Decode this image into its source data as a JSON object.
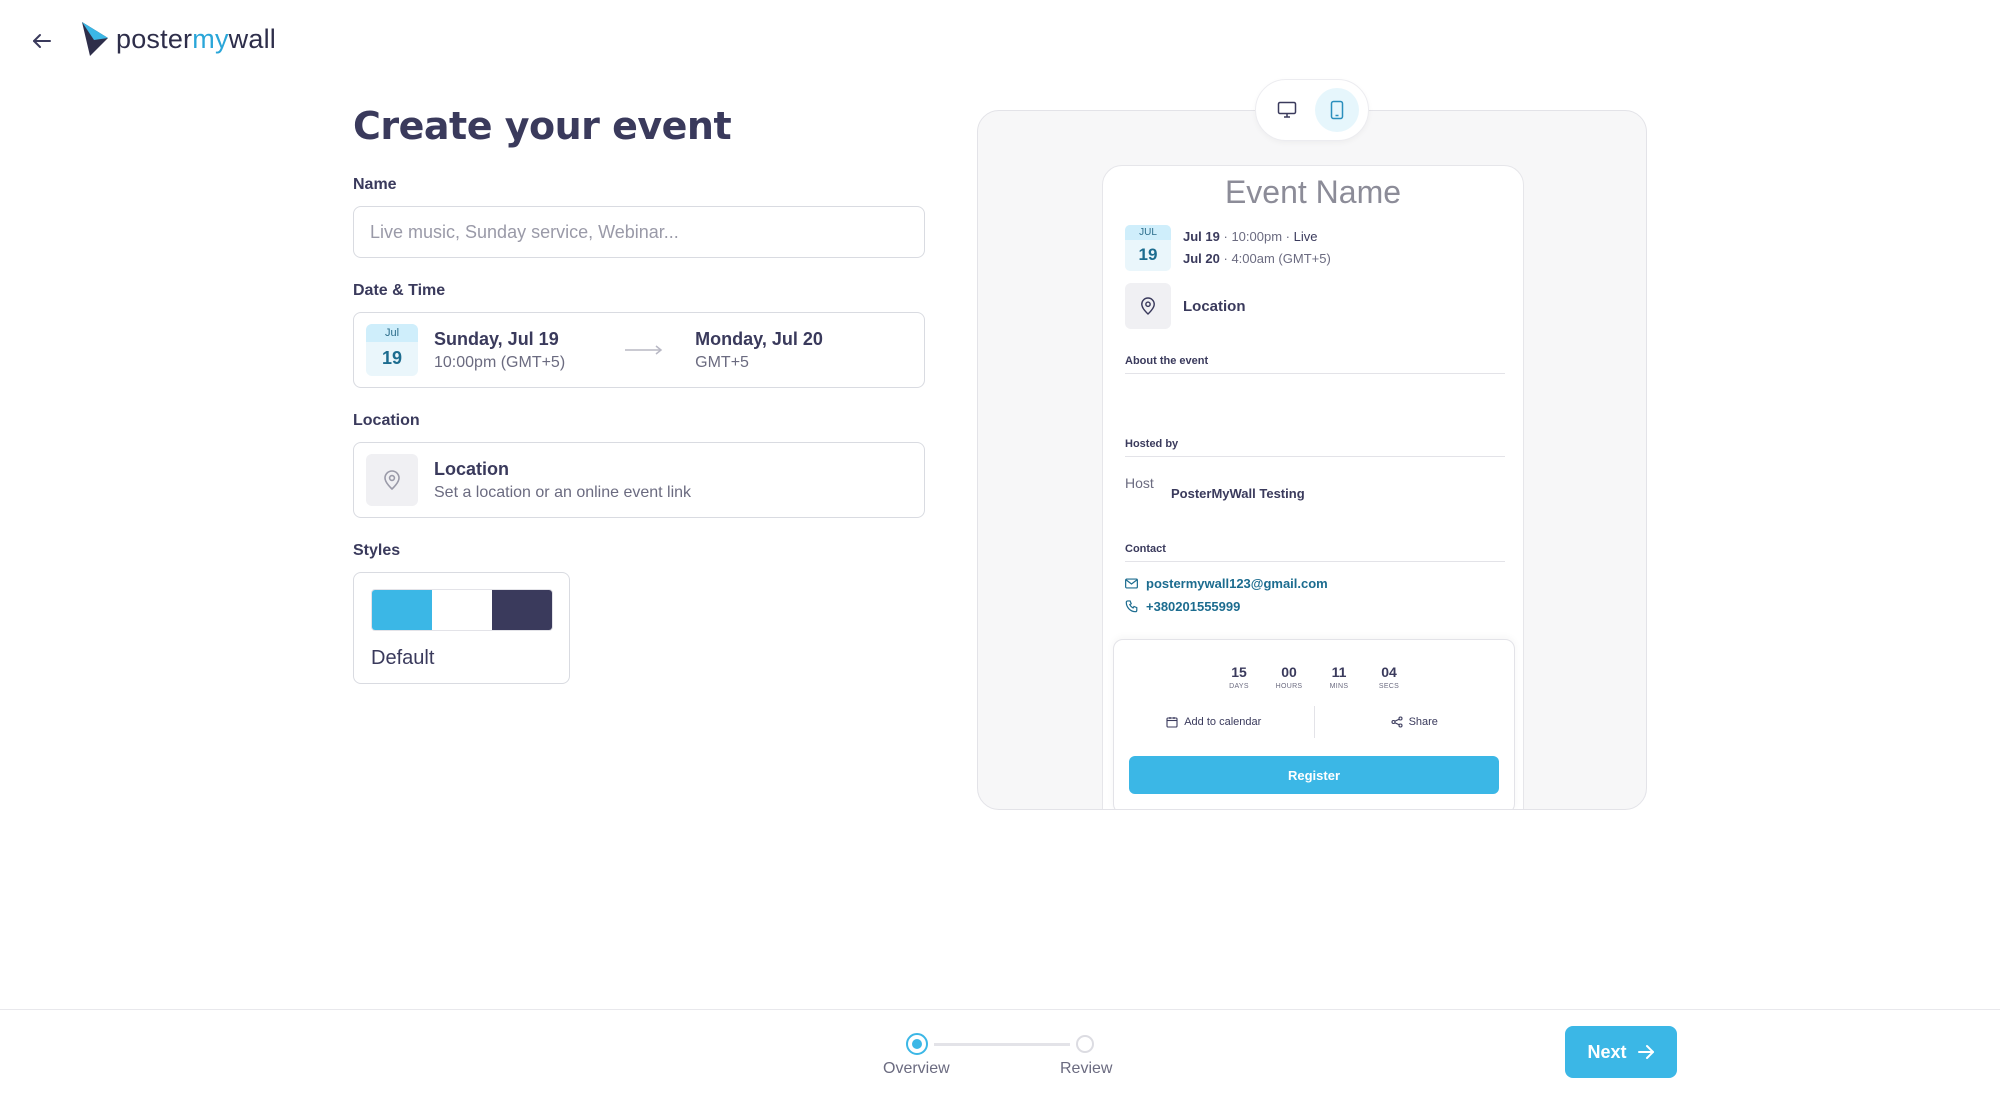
{
  "header": {
    "logo_prefix": "poster",
    "logo_accent": "my",
    "logo_suffix": "wall"
  },
  "form": {
    "title": "Create your event",
    "name": {
      "label": "Name",
      "placeholder": "Live music, Sunday service, Webinar...",
      "value": ""
    },
    "datetime": {
      "label": "Date & Time",
      "badge_month": "Jul",
      "badge_day": "19",
      "start_main": "Sunday, Jul 19",
      "start_sub": "10:00pm (GMT+5)",
      "end_main": "Monday, Jul 20",
      "end_sub": "GMT+5"
    },
    "location": {
      "label": "Location",
      "title": "Location",
      "subtitle": "Set a location or an online event link"
    },
    "styles": {
      "label": "Styles",
      "name": "Default",
      "colors": [
        "#3bb7e6",
        "#ffffff",
        "#3a3a5c"
      ]
    }
  },
  "preview": {
    "event_name": "Event Name",
    "cal_month": "JUL",
    "cal_day": "19",
    "start_date": "Jul 19",
    "start_time": "10:00pm",
    "mode": "Live",
    "end_date": "Jul 20",
    "end_time": "4:00am (GMT+5)",
    "location": "Location",
    "about_label": "About the event",
    "hosted_label": "Hosted by",
    "host_img_alt": "Host",
    "host_name": "PosterMyWall Testing",
    "contact_label": "Contact",
    "email": "postermywall123@gmail.com",
    "phone": "+380201555999",
    "countdown": [
      {
        "value": "15",
        "label": "DAYS"
      },
      {
        "value": "00",
        "label": "HOURS"
      },
      {
        "value": "11",
        "label": "MINS"
      },
      {
        "value": "04",
        "label": "SECS"
      }
    ],
    "add_to_calendar": "Add to calendar",
    "share": "Share",
    "register": "Register"
  },
  "footer": {
    "steps": [
      "Overview",
      "Review"
    ],
    "next_label": "Next"
  },
  "colors": {
    "accent": "#3bb7e6",
    "dark": "#3a3a5c"
  }
}
